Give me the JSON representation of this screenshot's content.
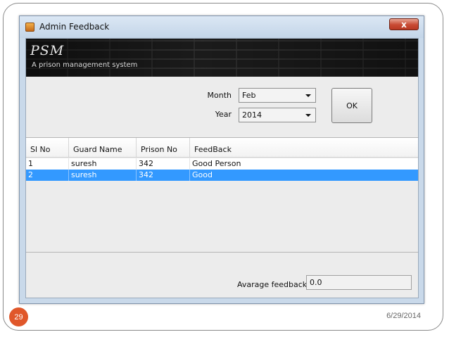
{
  "slide": {
    "number": "29",
    "date": "6/29/2014",
    "number_color": "#e0572a"
  },
  "window": {
    "title": "Admin Feedback",
    "close_label": "x",
    "app_icon": "java-cup-icon"
  },
  "banner": {
    "title": "PSM",
    "subtitle": "A prison management system"
  },
  "form": {
    "month_label": "Month",
    "month_value": "Feb",
    "year_label": "Year",
    "year_value": "2014",
    "ok_label": "OK"
  },
  "table": {
    "columns": [
      "Sl No",
      "Guard Name",
      "Prison No",
      "FeedBack"
    ],
    "rows": [
      {
        "sl": "1",
        "guard": "suresh",
        "prison": "342",
        "feedback": "Good Person",
        "selected": false
      },
      {
        "sl": "2",
        "guard": "suresh",
        "prison": "342",
        "feedback": "Good",
        "selected": true
      }
    ],
    "selection_color": "#3399ff"
  },
  "footer": {
    "avg_label": "Avarage feedback",
    "avg_value": "0.0"
  }
}
